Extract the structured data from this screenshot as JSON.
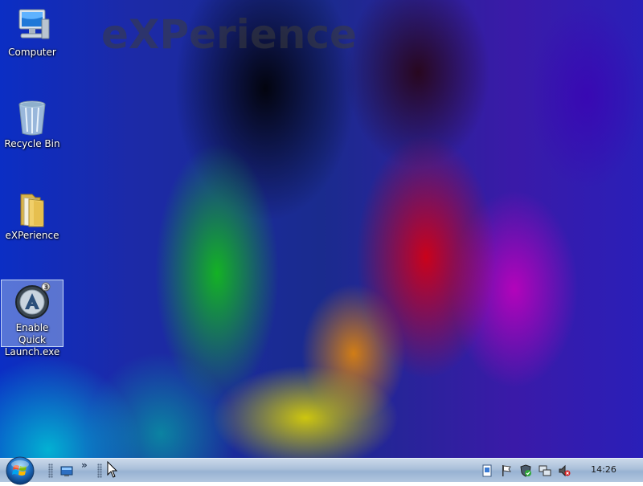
{
  "desktop": {
    "brand_text": "eXPerience",
    "icons": [
      {
        "label": "Computer"
      },
      {
        "label": "Recycle Bin"
      },
      {
        "label": "eXPerience"
      },
      {
        "label": "Enable Quick Launch.exe"
      }
    ]
  },
  "taskbar": {
    "start_icon": "windows-start-orb",
    "quick_launch": [
      {
        "icon": "show-desktop-icon"
      }
    ],
    "overflow_glyph": "»",
    "tray_icons": [
      "document-icon",
      "flag-icon",
      "security-shield-icon",
      "network-icon",
      "volume-muted-icon"
    ],
    "clock": "14:26"
  },
  "colors": {
    "taskbar": "#a9bfd9",
    "selection": "#b4cdf0"
  }
}
